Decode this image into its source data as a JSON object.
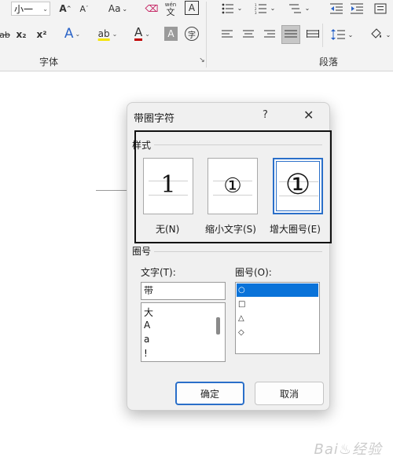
{
  "ribbon": {
    "font_size_value": "小一",
    "grow_font_label": "A",
    "shrink_font_label": "A",
    "change_case_label": "Aa",
    "phonetic_top": "wén",
    "phonetic_bottom": "文",
    "char_border_label": "A",
    "strike_label": "ab",
    "subscript_label": "x₂",
    "superscript_label": "x²",
    "text_effect_label": "A",
    "highlight_label": "ab",
    "font_color_label": "A",
    "char_shading_label": "A",
    "enclose_char_label": "字",
    "font_group_label": "字体",
    "paragraph_group_label": "段落"
  },
  "dialog": {
    "title": "带圈字符",
    "help": "?",
    "close": "✕",
    "style_section": "样式",
    "styles": [
      {
        "glyph": "1",
        "label": "无(N)"
      },
      {
        "glyph": "①",
        "label": "缩小文字(S)"
      },
      {
        "glyph": "①",
        "label": "增大圈号(E)"
      }
    ],
    "enclosure_section": "圈号",
    "text_label": "文字(T):",
    "text_value": "带",
    "text_options": [
      "大",
      "A",
      "a",
      "!"
    ],
    "enclosure_label": "圈号(O):",
    "enclosure_options": [
      "○",
      "□",
      "△",
      "◇"
    ],
    "ok": "确定",
    "cancel": "取消"
  },
  "watermark": "Bai♨经验"
}
